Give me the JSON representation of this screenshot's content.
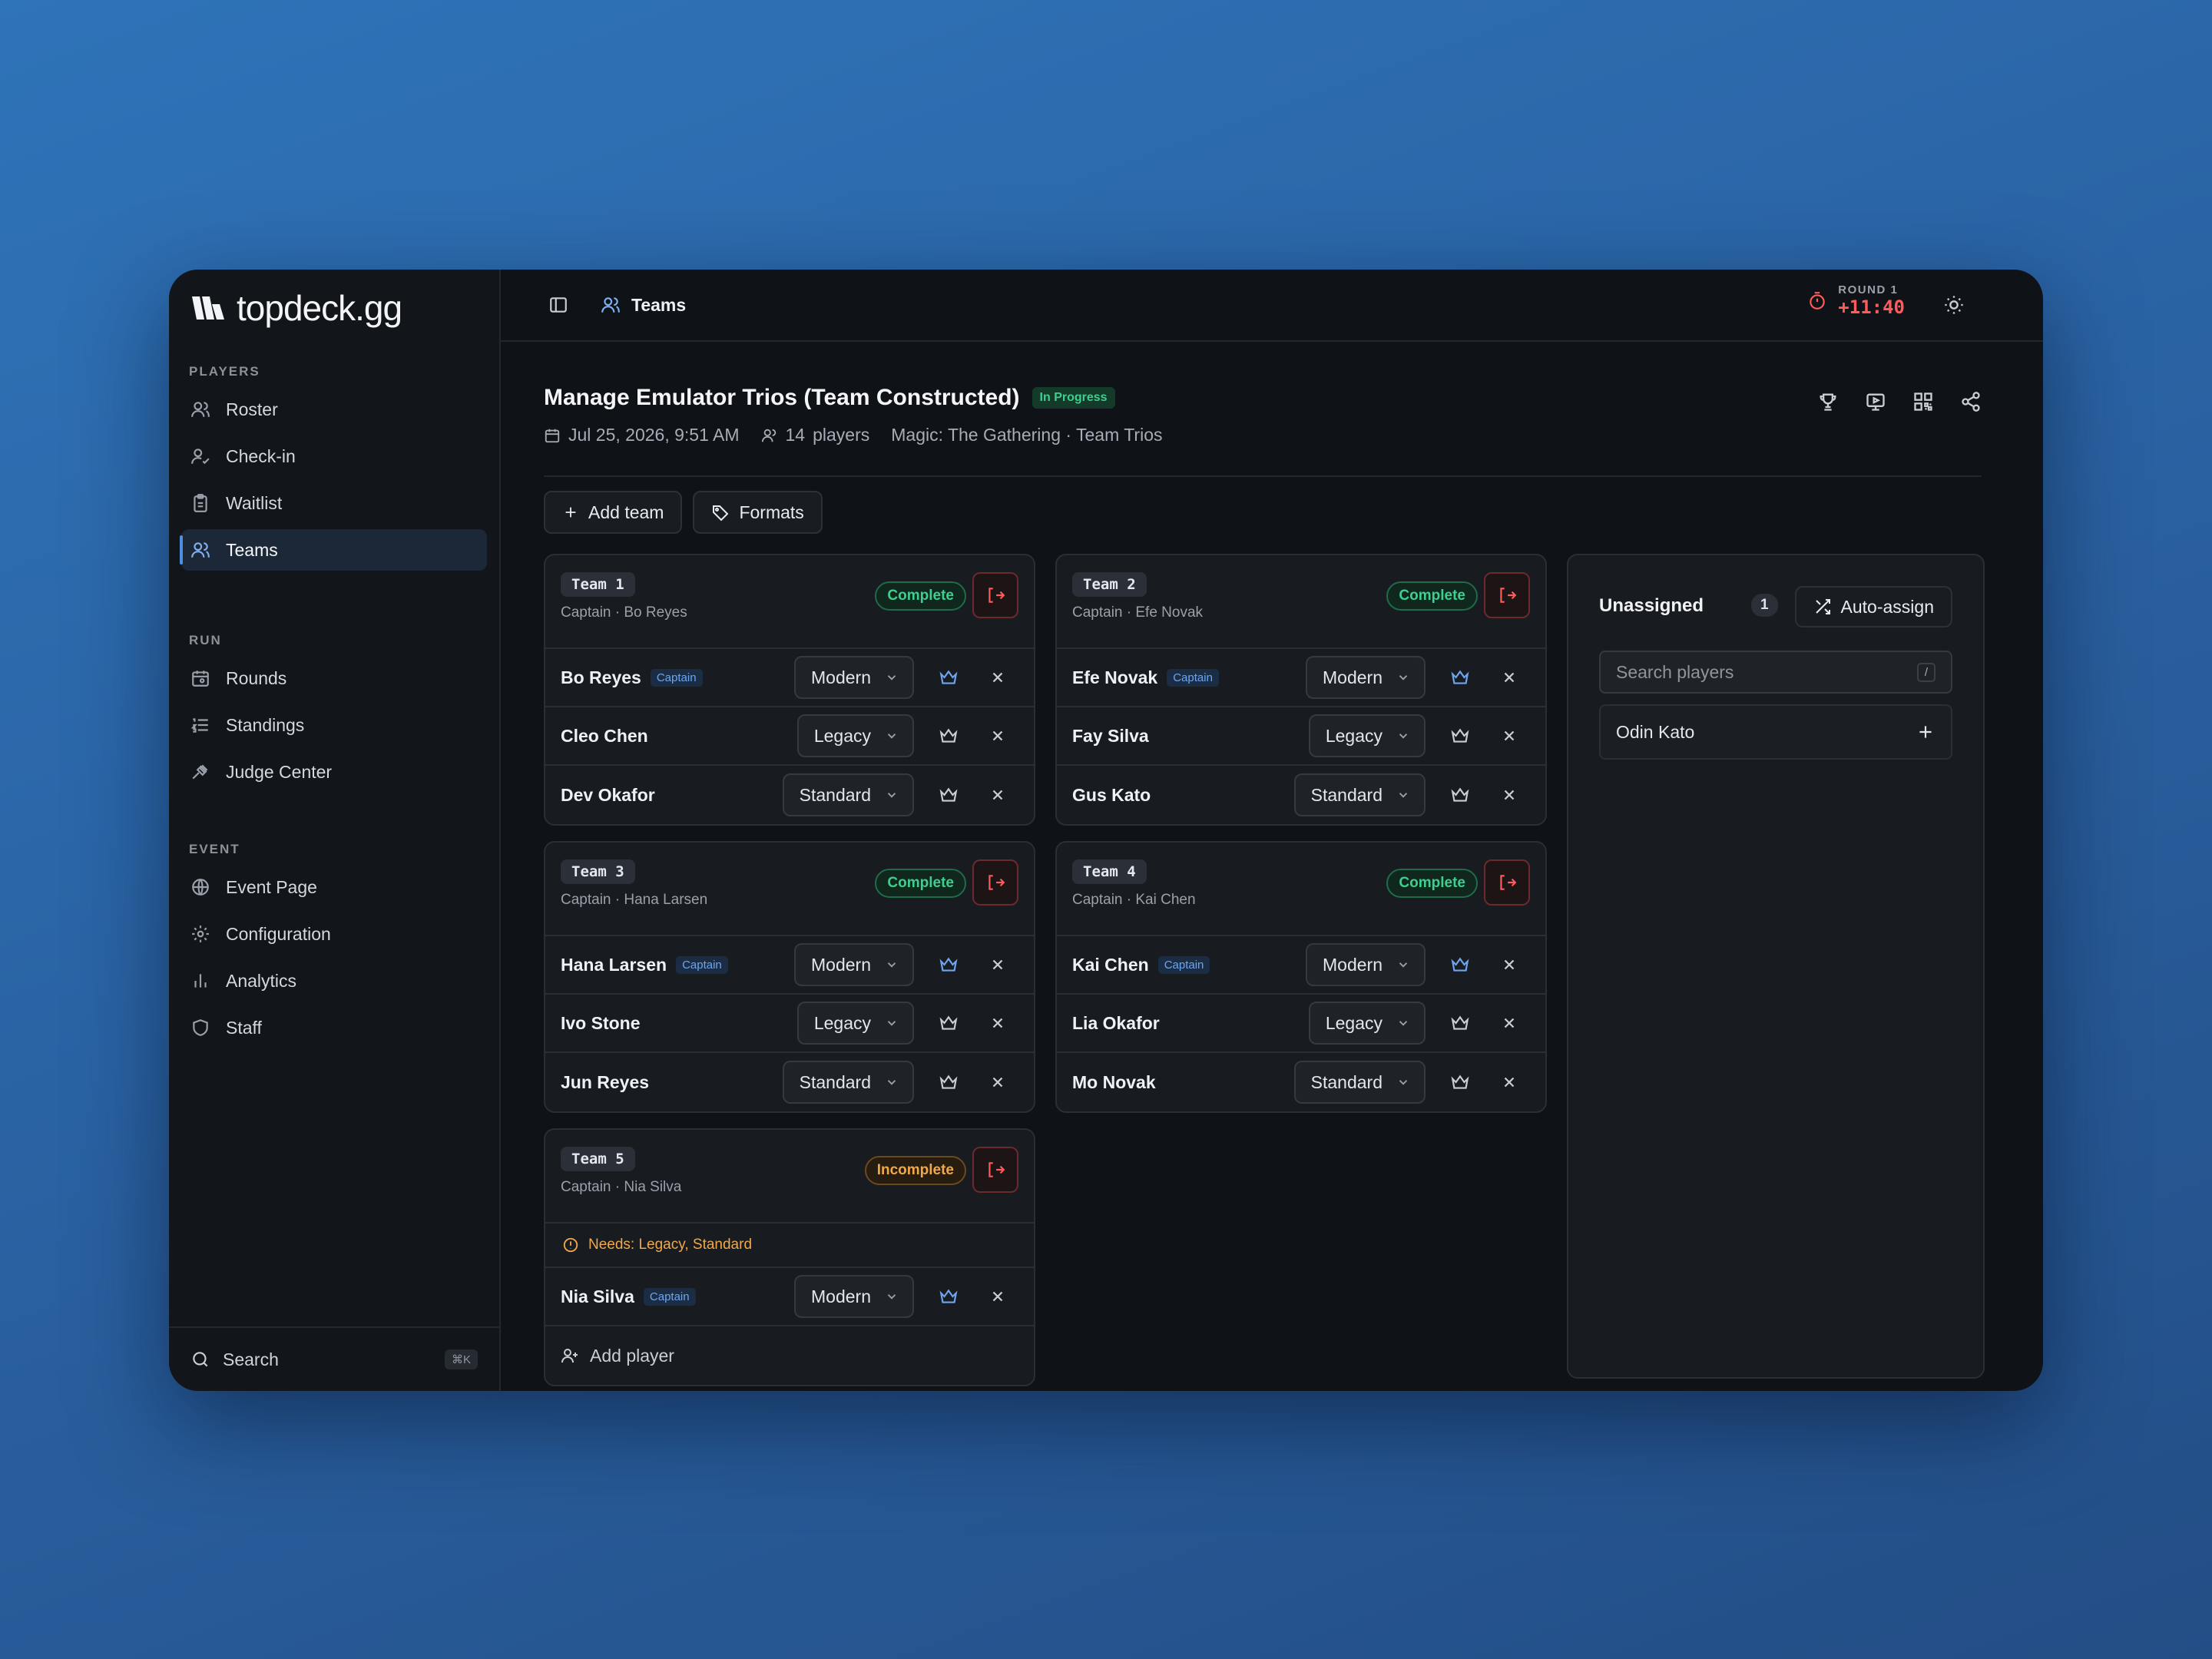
{
  "brand": {
    "name": "topdeck.gg"
  },
  "sidebar": {
    "sections": [
      {
        "title": "PLAYERS",
        "items": [
          {
            "label": "Roster",
            "icon": "users-icon"
          },
          {
            "label": "Check-in",
            "icon": "user-check-icon"
          },
          {
            "label": "Waitlist",
            "icon": "clipboard-icon"
          },
          {
            "label": "Teams",
            "icon": "users-icon",
            "active": true
          }
        ]
      },
      {
        "title": "RUN",
        "items": [
          {
            "label": "Rounds",
            "icon": "calendar-icon"
          },
          {
            "label": "Standings",
            "icon": "list-icon"
          },
          {
            "label": "Judge Center",
            "icon": "gavel-icon"
          }
        ]
      },
      {
        "title": "EVENT",
        "items": [
          {
            "label": "Event Page",
            "icon": "globe-icon"
          },
          {
            "label": "Configuration",
            "icon": "gear-icon"
          },
          {
            "label": "Analytics",
            "icon": "bar-chart-icon"
          },
          {
            "label": "Staff",
            "icon": "shield-icon"
          }
        ]
      }
    ],
    "search": {
      "label": "Search",
      "shortcut": "⌘K"
    }
  },
  "topbar": {
    "breadcrumb": "Teams",
    "round_label": "ROUND 1",
    "round_time": "+11:40"
  },
  "event": {
    "title": "Manage Emulator Trios (Team Constructed)",
    "status": "In Progress",
    "date": "Jul 25, 2026, 9:51 AM",
    "players": "14",
    "players_label": "players",
    "game": "Magic: The Gathering · Team Trios"
  },
  "toolbar": {
    "add_team": "Add team",
    "formats": "Formats"
  },
  "teams": [
    {
      "name": "Team 1",
      "captain_line": "Captain · Bo Reyes",
      "status": "Complete",
      "players": [
        {
          "name": "Bo Reyes",
          "captain": true,
          "format": "Modern"
        },
        {
          "name": "Cleo Chen",
          "captain": false,
          "format": "Legacy"
        },
        {
          "name": "Dev Okafor",
          "captain": false,
          "format": "Standard"
        }
      ]
    },
    {
      "name": "Team 2",
      "captain_line": "Captain · Efe Novak",
      "status": "Complete",
      "players": [
        {
          "name": "Efe Novak",
          "captain": true,
          "format": "Modern"
        },
        {
          "name": "Fay Silva",
          "captain": false,
          "format": "Legacy"
        },
        {
          "name": "Gus Kato",
          "captain": false,
          "format": "Standard"
        }
      ]
    },
    {
      "name": "Team 3",
      "captain_line": "Captain · Hana Larsen",
      "status": "Complete",
      "players": [
        {
          "name": "Hana Larsen",
          "captain": true,
          "format": "Modern"
        },
        {
          "name": "Ivo Stone",
          "captain": false,
          "format": "Legacy"
        },
        {
          "name": "Jun Reyes",
          "captain": false,
          "format": "Standard"
        }
      ]
    },
    {
      "name": "Team 4",
      "captain_line": "Captain · Kai Chen",
      "status": "Complete",
      "players": [
        {
          "name": "Kai Chen",
          "captain": true,
          "format": "Modern"
        },
        {
          "name": "Lia Okafor",
          "captain": false,
          "format": "Legacy"
        },
        {
          "name": "Mo Novak",
          "captain": false,
          "format": "Standard"
        }
      ]
    },
    {
      "name": "Team 5",
      "captain_line": "Captain · Nia Silva",
      "status": "Incomplete",
      "warning": "Needs: Legacy, Standard",
      "players": [
        {
          "name": "Nia Silva",
          "captain": true,
          "format": "Modern"
        }
      ],
      "add_player": "Add player"
    }
  ],
  "captain_badge": "Captain",
  "unassigned": {
    "title": "Unassigned",
    "count": "1",
    "auto_assign": "Auto-assign",
    "search_placeholder": "Search players",
    "search_shortcut": "/",
    "players": [
      "Odin Kato"
    ]
  },
  "colors": {
    "accent": "#4a8fe0",
    "success": "#3ecf8e",
    "warning": "#f0a94a",
    "danger": "#ff5b5b",
    "background": "#0f1216"
  }
}
